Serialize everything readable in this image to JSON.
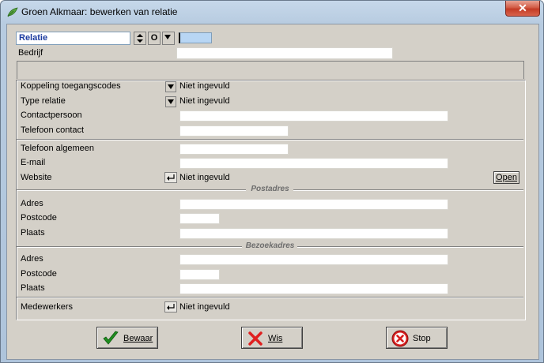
{
  "window": {
    "title": "Groen Alkmaar: bewerken van relatie",
    "close_label": "✕"
  },
  "top": {
    "relatie_value": "Relatie",
    "o_button": "O",
    "bedrijf_label": "Bedrijf",
    "bedrijf_value": ""
  },
  "form": {
    "koppeling_label": "Koppeling toegangscodes",
    "koppeling_value": "Niet ingevuld",
    "type_label": "Type relatie",
    "type_value": "Niet ingevuld",
    "contactpersoon_label": "Contactpersoon",
    "contactpersoon_value": "",
    "telefoon_contact_label": "Telefoon contact",
    "telefoon_contact_value": "",
    "telefoon_algemeen_label": "Telefoon algemeen",
    "telefoon_algemeen_value": "",
    "email_label": "E-mail",
    "email_value": "",
    "website_label": "Website",
    "website_value": "Niet ingevuld",
    "open_button": "Open",
    "postadres": {
      "header": "Postadres",
      "adres_label": "Adres",
      "postcode_label": "Postcode",
      "plaats_label": "Plaats"
    },
    "bezoekadres": {
      "header": "Bezoekadres",
      "adres_label": "Adres",
      "postcode_label": "Postcode",
      "plaats_label": "Plaats"
    },
    "medewerkers_label": "Medewerkers",
    "medewerkers_value": "Niet ingevuld"
  },
  "buttons": {
    "bewaar": "Bewaar",
    "wis": "Wis",
    "stop": "Stop"
  },
  "colors": {
    "relatie_text": "#1a3aa0",
    "ok_green": "#1f8e1f",
    "cancel_red": "#e02020",
    "stop_red": "#d81e1e"
  }
}
